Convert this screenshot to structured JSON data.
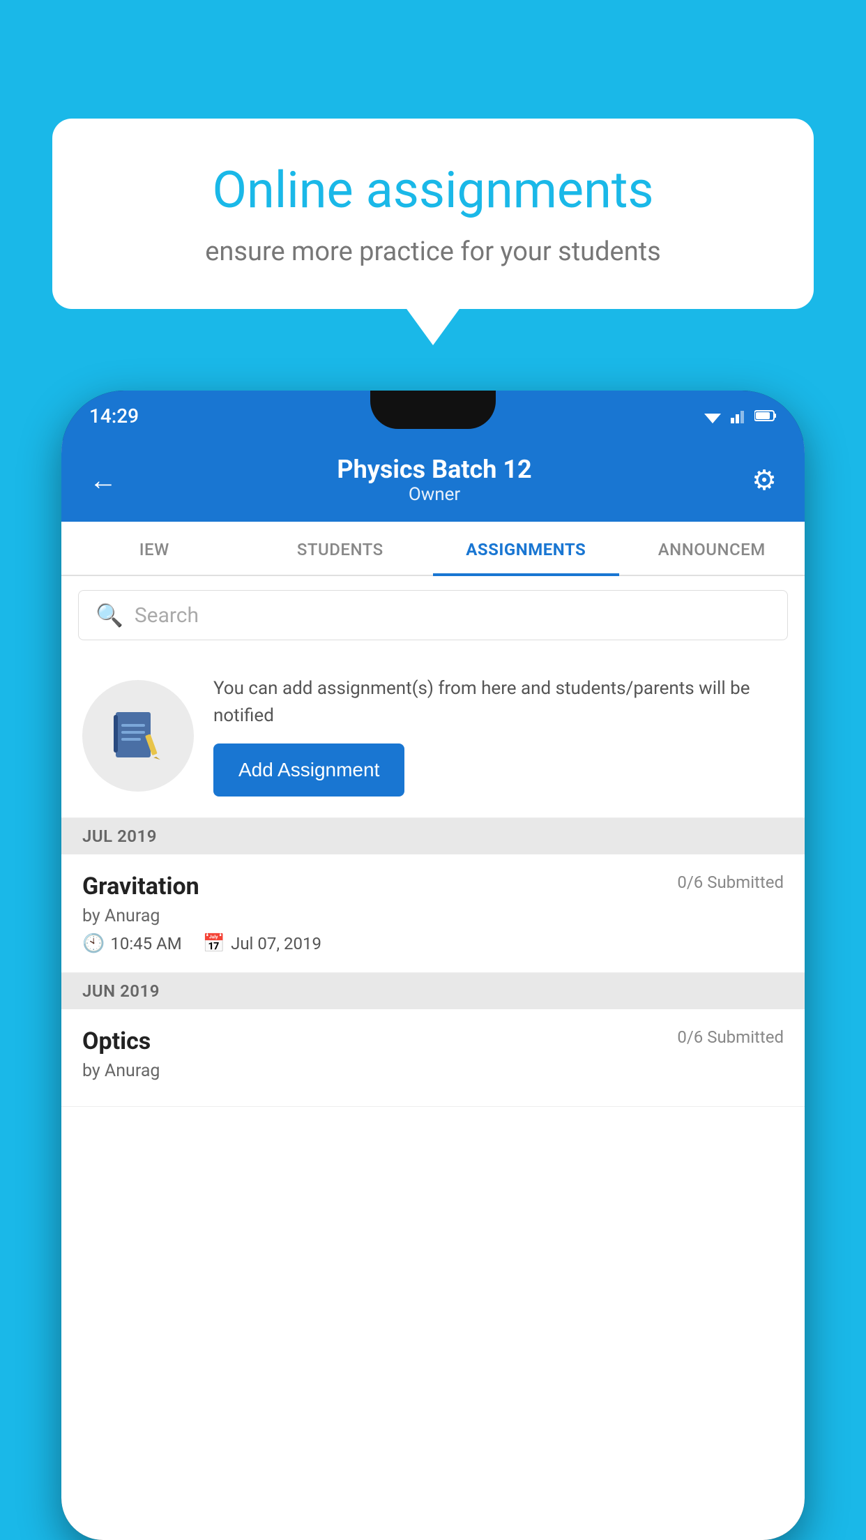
{
  "background_color": "#1ab8e8",
  "speech_bubble": {
    "title": "Online assignments",
    "subtitle": "ensure more practice for your students"
  },
  "phone": {
    "status_bar": {
      "time": "14:29"
    },
    "header": {
      "title": "Physics Batch 12",
      "subtitle": "Owner",
      "back_label": "←",
      "gear_label": "⚙"
    },
    "tabs": [
      {
        "label": "IEW",
        "active": false
      },
      {
        "label": "STUDENTS",
        "active": false
      },
      {
        "label": "ASSIGNMENTS",
        "active": true
      },
      {
        "label": "ANNOUNCEM",
        "active": false
      }
    ],
    "search": {
      "placeholder": "Search"
    },
    "promo": {
      "text": "You can add assignment(s) from here and students/parents will be notified",
      "button_label": "Add Assignment"
    },
    "sections": [
      {
        "month": "JUL 2019",
        "assignments": [
          {
            "title": "Gravitation",
            "submitted": "0/6 Submitted",
            "author": "by Anurag",
            "time": "10:45 AM",
            "date": "Jul 07, 2019"
          }
        ]
      },
      {
        "month": "JUN 2019",
        "assignments": [
          {
            "title": "Optics",
            "submitted": "0/6 Submitted",
            "author": "by Anurag",
            "time": "",
            "date": ""
          }
        ]
      }
    ]
  }
}
